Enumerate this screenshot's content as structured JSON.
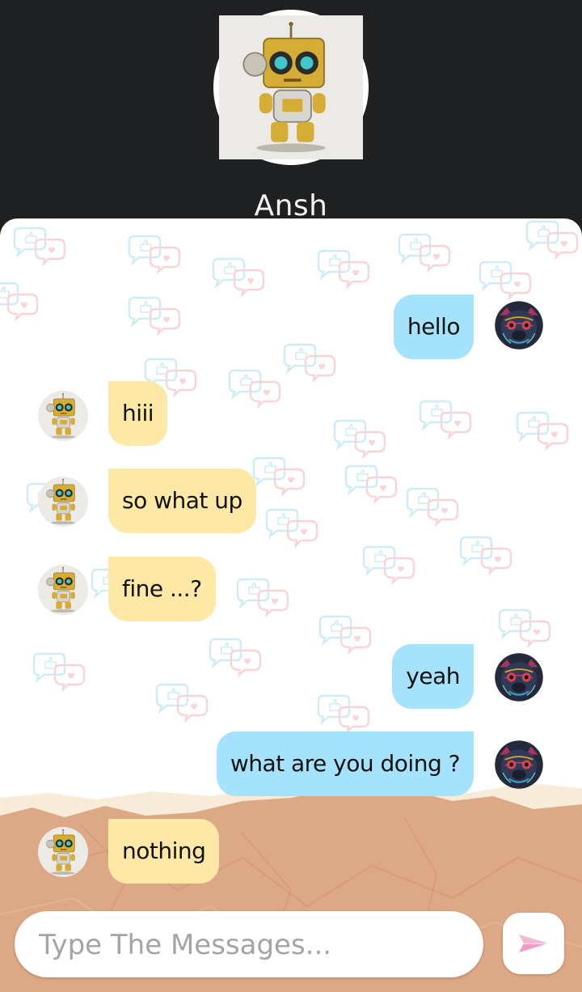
{
  "contact": {
    "name": "Ansh",
    "avatar_icon": "robot-avatar-icon"
  },
  "messages": [
    {
      "direction": "sent",
      "text": "hello"
    },
    {
      "direction": "received",
      "text": "hiii"
    },
    {
      "direction": "received",
      "text": "so what up"
    },
    {
      "direction": "received",
      "text": "fine ...?"
    },
    {
      "direction": "sent",
      "text": "yeah"
    },
    {
      "direction": "sent",
      "text": "what are you doing ?"
    },
    {
      "direction": "received",
      "text": "nothing"
    }
  ],
  "composer": {
    "placeholder": "Type The Messages...",
    "value": ""
  },
  "send": {
    "icon": "paper-plane-icon"
  },
  "colors": {
    "header_bg": "#1f2021",
    "sent_bubble": "#a5e2fb",
    "received_bubble": "#fde8a5",
    "send_icon": "#f49ac2"
  }
}
